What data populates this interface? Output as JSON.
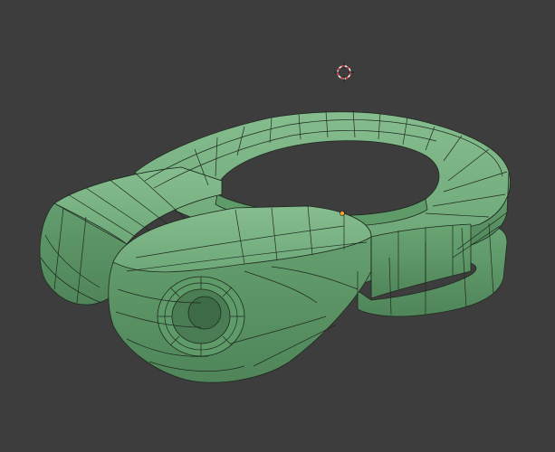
{
  "viewport": {
    "background": "#3d3d3d"
  },
  "mesh": {
    "object": "seatpost-clamp-mesh",
    "face_color": "#6fa97a",
    "face_shadow": "#5a9066",
    "face_light": "#8cc294",
    "wire_color": "#1f2a20",
    "shading": "solid-with-wireframe"
  },
  "icons": {
    "cursor": "3d-cursor-icon",
    "origin": "object-origin-icon"
  },
  "colors": {
    "cursor_red": "#e0383b",
    "cursor_white": "#f2f2f2",
    "origin_orange": "#ffa033"
  }
}
